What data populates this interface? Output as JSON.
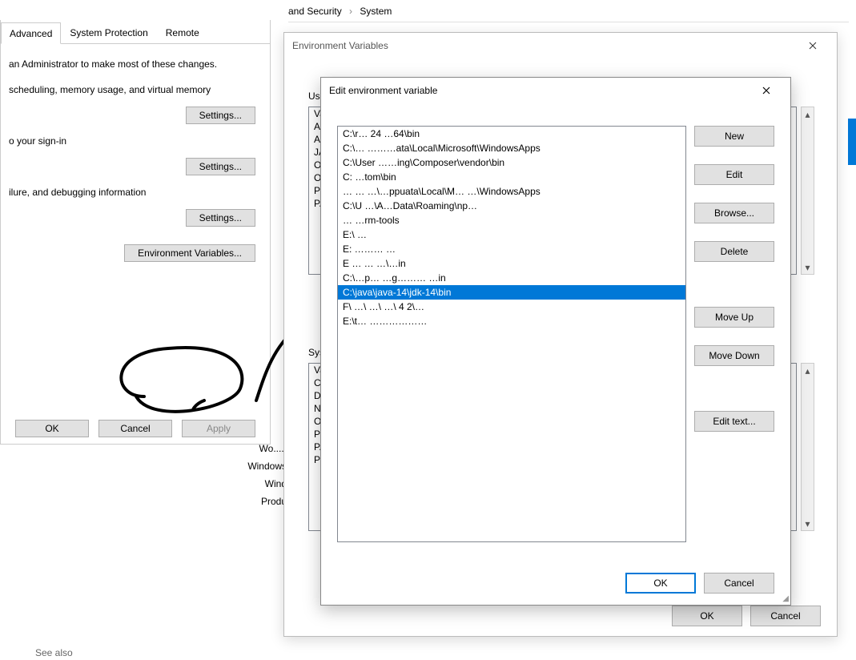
{
  "breadcrumb": {
    "seg1": "and Security",
    "seg2": "System",
    "sep": "›"
  },
  "system_props": {
    "tabs": {
      "advanced": "Advanced",
      "protection": "System Protection",
      "remote": "Remote"
    },
    "admin_text": "an Administrator to make most of these changes.",
    "perf_text": "scheduling, memory usage, and virtual memory",
    "profile_text": "o your sign-in",
    "startup_text": "ilure, and debugging information",
    "settings_label": "Settings...",
    "env_label": "Environment Variables...",
    "ok": "OK",
    "cancel": "Cancel",
    "apply": "Apply"
  },
  "labels_right": {
    "a": "Wo.....",
    "b": "Windows",
    "c": "Wind",
    "d": "Produ"
  },
  "seealso": "See also",
  "envwin": {
    "title": "Environment Variables",
    "user_label": "Use",
    "sys_label": "Syst",
    "user_vars": [
      "Va",
      "AN",
      "AN",
      "JA",
      "On",
      "O",
      "Pa",
      "PA"
    ],
    "sys_vars": [
      "Va",
      "Cc",
      "Dr",
      "NU",
      "OS",
      "Pa",
      "PA",
      "PR"
    ],
    "ok": "OK",
    "cancel": "Cancel"
  },
  "editwin": {
    "title": "Edit environment variable",
    "paths": [
      "C:\\r…            24 …64\\bin",
      "C:\\…                         ………ata\\Local\\Microsoft\\WindowsApps",
      "C:\\User                                     ……ing\\Composer\\vendor\\bin",
      "C:                                                     …tom\\bin",
      "…                  … …\\…ppuata\\Local\\M…        …\\WindowsApps",
      "C:\\U              …\\A…Data\\Roaming\\np…",
      "…                                          …rm-tools",
      "E:\\ …",
      "E:                                        ……… …",
      "E                     … … …\\…in",
      "C:\\…p…         …g………            …in",
      "C:\\java\\java-14\\jdk-14\\bin",
      "F\\   …\\ …\\         …\\ 4 2\\…",
      "E:\\t…                                 ………………"
    ],
    "selected_index": 11,
    "buttons": {
      "new": "New",
      "edit": "Edit",
      "browse": "Browse...",
      "delete": "Delete",
      "moveup": "Move Up",
      "movedown": "Move Down",
      "edittext": "Edit text..."
    },
    "ok": "OK",
    "cancel": "Cancel"
  }
}
